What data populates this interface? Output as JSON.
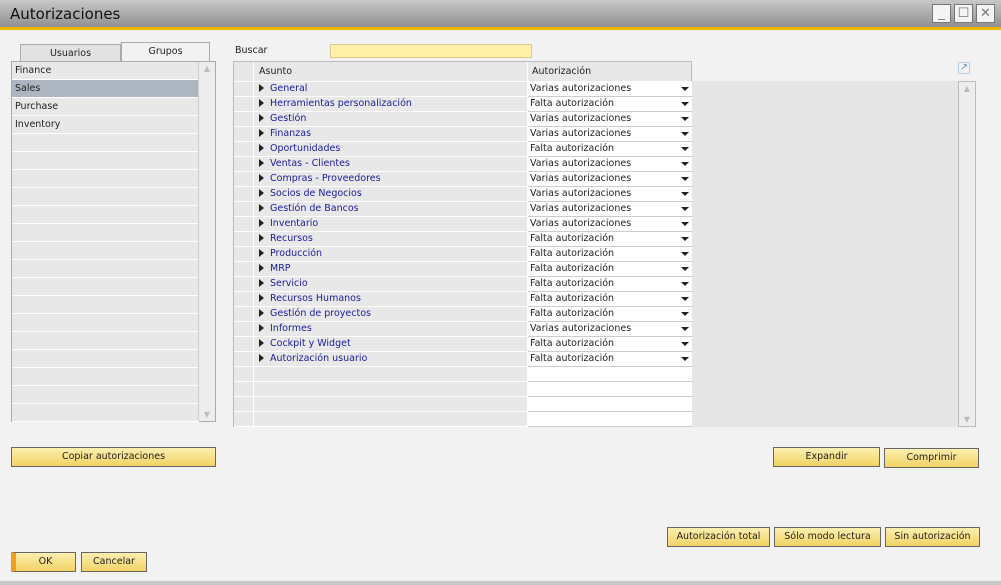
{
  "window": {
    "title": "Autorizaciones",
    "minimize": "_",
    "maximize": "☐",
    "close": "✕"
  },
  "tabs": [
    {
      "label": "Usuarios",
      "active": false
    },
    {
      "label": "Grupos",
      "active": true
    }
  ],
  "groups": [
    "Finance",
    "Sales",
    "Purchase",
    "Inventory"
  ],
  "selected_group": "Sales",
  "search": {
    "label": "Buscar",
    "value": ""
  },
  "grid": {
    "headers": {
      "subject": "Asunto",
      "authorization": "Autorización"
    },
    "rows": [
      {
        "subject": "General",
        "auth": "Varias autorizaciones"
      },
      {
        "subject": "Herramientas personalización",
        "auth": "Falta autorización"
      },
      {
        "subject": "Gestión",
        "auth": "Varias autorizaciones"
      },
      {
        "subject": "Finanzas",
        "auth": "Varias autorizaciones"
      },
      {
        "subject": "Oportunidades",
        "auth": "Falta autorización"
      },
      {
        "subject": "Ventas - Clientes",
        "auth": "Varias autorizaciones"
      },
      {
        "subject": "Compras - Proveedores",
        "auth": "Varias autorizaciones"
      },
      {
        "subject": "Socios de Negocios",
        "auth": "Varias autorizaciones"
      },
      {
        "subject": "Gestión de Bancos",
        "auth": "Varias autorizaciones"
      },
      {
        "subject": "Inventario",
        "auth": "Varias autorizaciones"
      },
      {
        "subject": "Recursos",
        "auth": "Falta autorización"
      },
      {
        "subject": "Producción",
        "auth": "Falta autorización"
      },
      {
        "subject": "MRP",
        "auth": "Falta autorización"
      },
      {
        "subject": "Servicio",
        "auth": "Falta autorización"
      },
      {
        "subject": "Recursos Humanos",
        "auth": "Falta autorización"
      },
      {
        "subject": "Gestión de proyectos",
        "auth": "Falta autorización"
      },
      {
        "subject": "Informes",
        "auth": "Varias autorizaciones"
      },
      {
        "subject": "Cockpit y Widget",
        "auth": "Falta autorización"
      },
      {
        "subject": "Autorización usuario",
        "auth": "Falta autorización"
      }
    ]
  },
  "buttons": {
    "copy": "Copiar autorizaciones",
    "expand": "Expandir",
    "collapse": "Comprimir",
    "full": "Autorización total",
    "readonly": "Sólo modo lectura",
    "none": "Sin autorización",
    "ok": "OK",
    "cancel": "Cancelar"
  },
  "colors": {
    "accent": "#f4b400",
    "selected_row": "#adb5c0",
    "link": "#1c1c9a",
    "button": "#f2d264"
  }
}
